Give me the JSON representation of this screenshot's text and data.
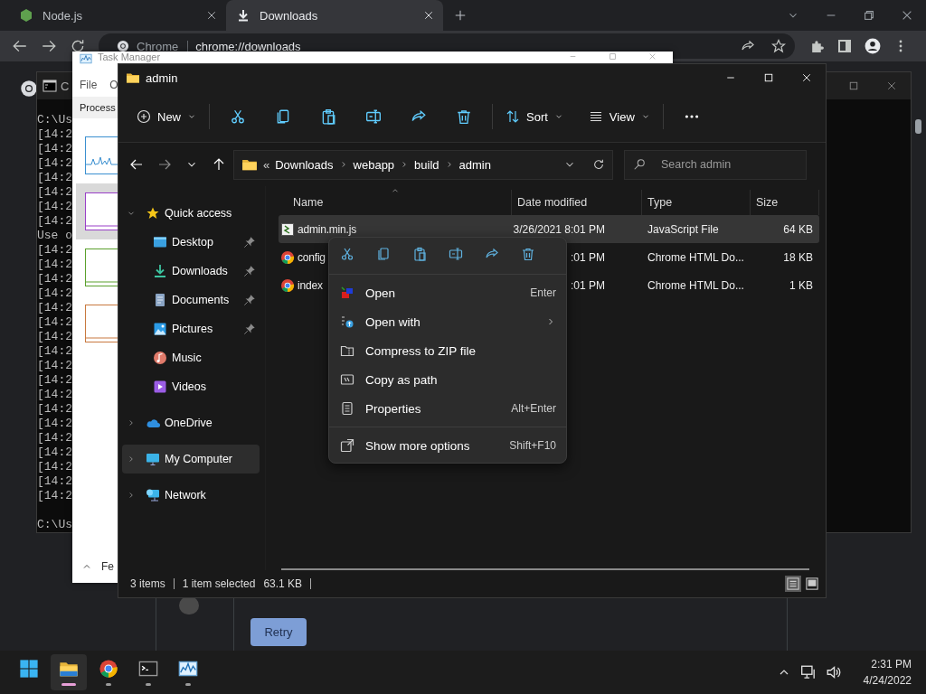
{
  "browser": {
    "tabs": [
      {
        "label": "Node.js",
        "kind": "node",
        "selected": false
      },
      {
        "label": "Downloads",
        "kind": "download",
        "selected": true
      }
    ],
    "omnibox": {
      "site": "Chrome",
      "url": "chrome://downloads"
    },
    "page": {
      "button": "Retry"
    }
  },
  "console": {
    "title": "C",
    "blocks": [
      [
        "C:\\Us",
        "[14:2",
        "[14:2",
        "[14:2",
        "[14:2",
        "[14:2",
        "[14:2",
        "[14:2",
        "Use o",
        "[14:2",
        "[14:2",
        "[14:2",
        "[14:2",
        "[14:2",
        "[14:2",
        "[14:2",
        "[14:2",
        "[14:2",
        "[14:2",
        "[14:2",
        "[14:2",
        "[14:2",
        "[14:2",
        "[14:2",
        "[14:2",
        "[14:2",
        "[14:2"
      ],
      [
        "C:\\Us"
      ]
    ]
  },
  "task_manager": {
    "title": "Task Manager",
    "menu": [
      "File",
      "O"
    ],
    "tab": "Process",
    "details_toggle": "Fe",
    "graphs": [
      {
        "kind": "spiky",
        "color": "#3a8fd0",
        "selected": false
      },
      {
        "kind": "flat",
        "color": "#9a3fc8",
        "selected": true
      },
      {
        "kind": "flat",
        "color": "#5aa02c",
        "selected": false
      },
      {
        "kind": "flat",
        "color": "#c8783e",
        "selected": false
      }
    ]
  },
  "explorer": {
    "title": "admin",
    "toolbar": {
      "new": "New",
      "sort": "Sort",
      "view": "View"
    },
    "path_overflow": "«",
    "path": [
      "Downloads",
      "webapp",
      "build",
      "admin"
    ],
    "search": {
      "placeholder": "Search admin"
    },
    "nav": [
      {
        "label": "Quick access",
        "kind": "star",
        "expanded": true,
        "selected": false,
        "children": [
          {
            "label": "Desktop",
            "kind": "desktop",
            "pinned": true,
            "selected": false
          },
          {
            "label": "Downloads",
            "kind": "downloads",
            "pinned": true,
            "selected": false
          },
          {
            "label": "Documents",
            "kind": "documents",
            "pinned": true,
            "selected": false
          },
          {
            "label": "Pictures",
            "kind": "pictures",
            "pinned": true,
            "selected": false
          },
          {
            "label": "Music",
            "kind": "music",
            "pinned": false,
            "selected": false
          },
          {
            "label": "Videos",
            "kind": "videos",
            "pinned": false,
            "selected": false
          }
        ]
      },
      {
        "label": "OneDrive",
        "kind": "onedrive",
        "expanded": false,
        "selected": false
      },
      {
        "label": "My Computer",
        "kind": "computer",
        "expanded": false,
        "selected": true
      },
      {
        "label": "Network",
        "kind": "network",
        "expanded": false,
        "selected": false
      }
    ],
    "columns": [
      {
        "label": "Name",
        "sorted": true
      },
      {
        "label": "Date modified",
        "sorted": false
      },
      {
        "label": "Type",
        "sorted": false
      },
      {
        "label": "Size",
        "sorted": false
      }
    ],
    "files": [
      {
        "name": "admin.min.js",
        "kind": "js",
        "date": "3/26/2021 8:01 PM",
        "type": "JavaScript File",
        "size": "64 KB",
        "selected": true
      },
      {
        "name": "config",
        "kind": "chrome",
        "date": ":01 PM",
        "type": "Chrome HTML Do...",
        "size": "18 KB",
        "selected": false
      },
      {
        "name": "index",
        "kind": "chrome",
        "date": ":01 PM",
        "type": "Chrome HTML Do...",
        "size": "1 KB",
        "selected": false
      }
    ],
    "status": {
      "items": "3 items",
      "selection": "1 item selected",
      "size": "63.1 KB"
    },
    "views": [
      {
        "kind": "details",
        "selected": true
      },
      {
        "kind": "tiles",
        "selected": false
      }
    ]
  },
  "context_menu": {
    "groups": [
      [
        {
          "label": "Open",
          "kind": "open",
          "shortcut": "Enter",
          "submenu": false
        },
        {
          "label": "Open with",
          "kind": "open-with",
          "submenu": true
        },
        {
          "label": "Compress to ZIP file",
          "kind": "zip",
          "submenu": false
        },
        {
          "label": "Copy as path",
          "kind": "copy-path",
          "submenu": false
        },
        {
          "label": "Properties",
          "kind": "properties",
          "shortcut": "Alt+Enter",
          "submenu": false
        }
      ],
      [
        {
          "label": "Show more options",
          "kind": "show-more",
          "shortcut": "Shift+F10",
          "submenu": false
        }
      ]
    ]
  },
  "taskbar": {
    "apps": [
      {
        "kind": "start",
        "running": false,
        "active": false
      },
      {
        "kind": "explorer",
        "running": true,
        "active": true
      },
      {
        "kind": "chrome",
        "running": true,
        "active": false
      },
      {
        "kind": "terminal",
        "running": true,
        "active": false
      },
      {
        "kind": "taskmgr",
        "running": true,
        "active": false
      }
    ],
    "time": "2:31 PM",
    "date": "4/24/2022"
  }
}
